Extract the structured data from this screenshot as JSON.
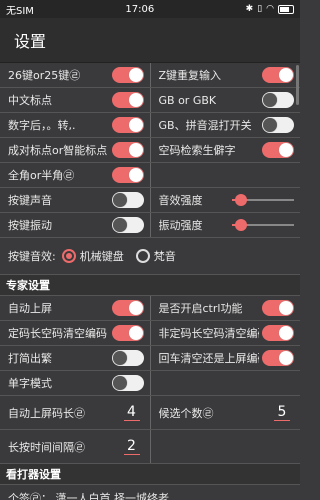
{
  "status": {
    "carrier": "无SIM",
    "time": "17:06",
    "icons": [
      "bluetooth-icon",
      "vibrate-icon",
      "wifi-icon",
      "battery-icon"
    ]
  },
  "title": "设置",
  "grid1": [
    [
      {
        "label": "26键or25键㉣",
        "state": "on"
      },
      {
        "label": "Z键重复输入",
        "state": "on"
      }
    ],
    [
      {
        "label": "中文标点",
        "state": "on"
      },
      {
        "label": "GB or GBK",
        "state": "off"
      }
    ],
    [
      {
        "label": "数字后，。转,.",
        "state": "on"
      },
      {
        "label": "GB、拼音混打开关",
        "state": "off"
      }
    ],
    [
      {
        "label": "成对标点or智能标点",
        "state": "on"
      },
      {
        "label": "空码检索生僻字",
        "state": "on"
      }
    ],
    [
      {
        "label": "全角or半角㉣",
        "state": "on"
      },
      null
    ]
  ],
  "sound": {
    "label": "按键声音",
    "state": "off",
    "slider_label": "音效强度",
    "slider_value": 0.15
  },
  "vibrate": {
    "label": "按键振动",
    "state": "off",
    "slider_label": "振动强度",
    "slider_value": 0.15
  },
  "key_effect": {
    "label": "按键音效:",
    "options": [
      "机械键盘",
      "梵音"
    ],
    "selected": 0
  },
  "expert": {
    "section_title": "专家设置",
    "grid": [
      [
        {
          "label": "自动上屏",
          "state": "on"
        },
        {
          "label": "是否开启ctrl功能",
          "state": "on"
        }
      ],
      [
        {
          "label": "定码长空码清空编码",
          "state": "on"
        },
        {
          "label": "非定码长空码清空编码",
          "state": "on"
        }
      ],
      [
        {
          "label": "打简出繁",
          "state": "off"
        },
        {
          "label": "回车清空还是上屏编码",
          "state": "on"
        }
      ],
      [
        {
          "label": "单字模式",
          "state": "off"
        },
        null
      ]
    ],
    "auto_len": {
      "label": "自动上屏码长㉣",
      "value": "4"
    },
    "candidates": {
      "label": "候选个数㉣",
      "value": "5"
    },
    "long_press": {
      "label": "长按时间间隔㉣",
      "value": "2"
    }
  },
  "typer": {
    "section_title": "看打器设置",
    "partial_text": "个签㉣：  潇一人白首 择一城终老"
  },
  "colors": {
    "accent": "#ee6b6b",
    "background": "#3a3a3c"
  }
}
